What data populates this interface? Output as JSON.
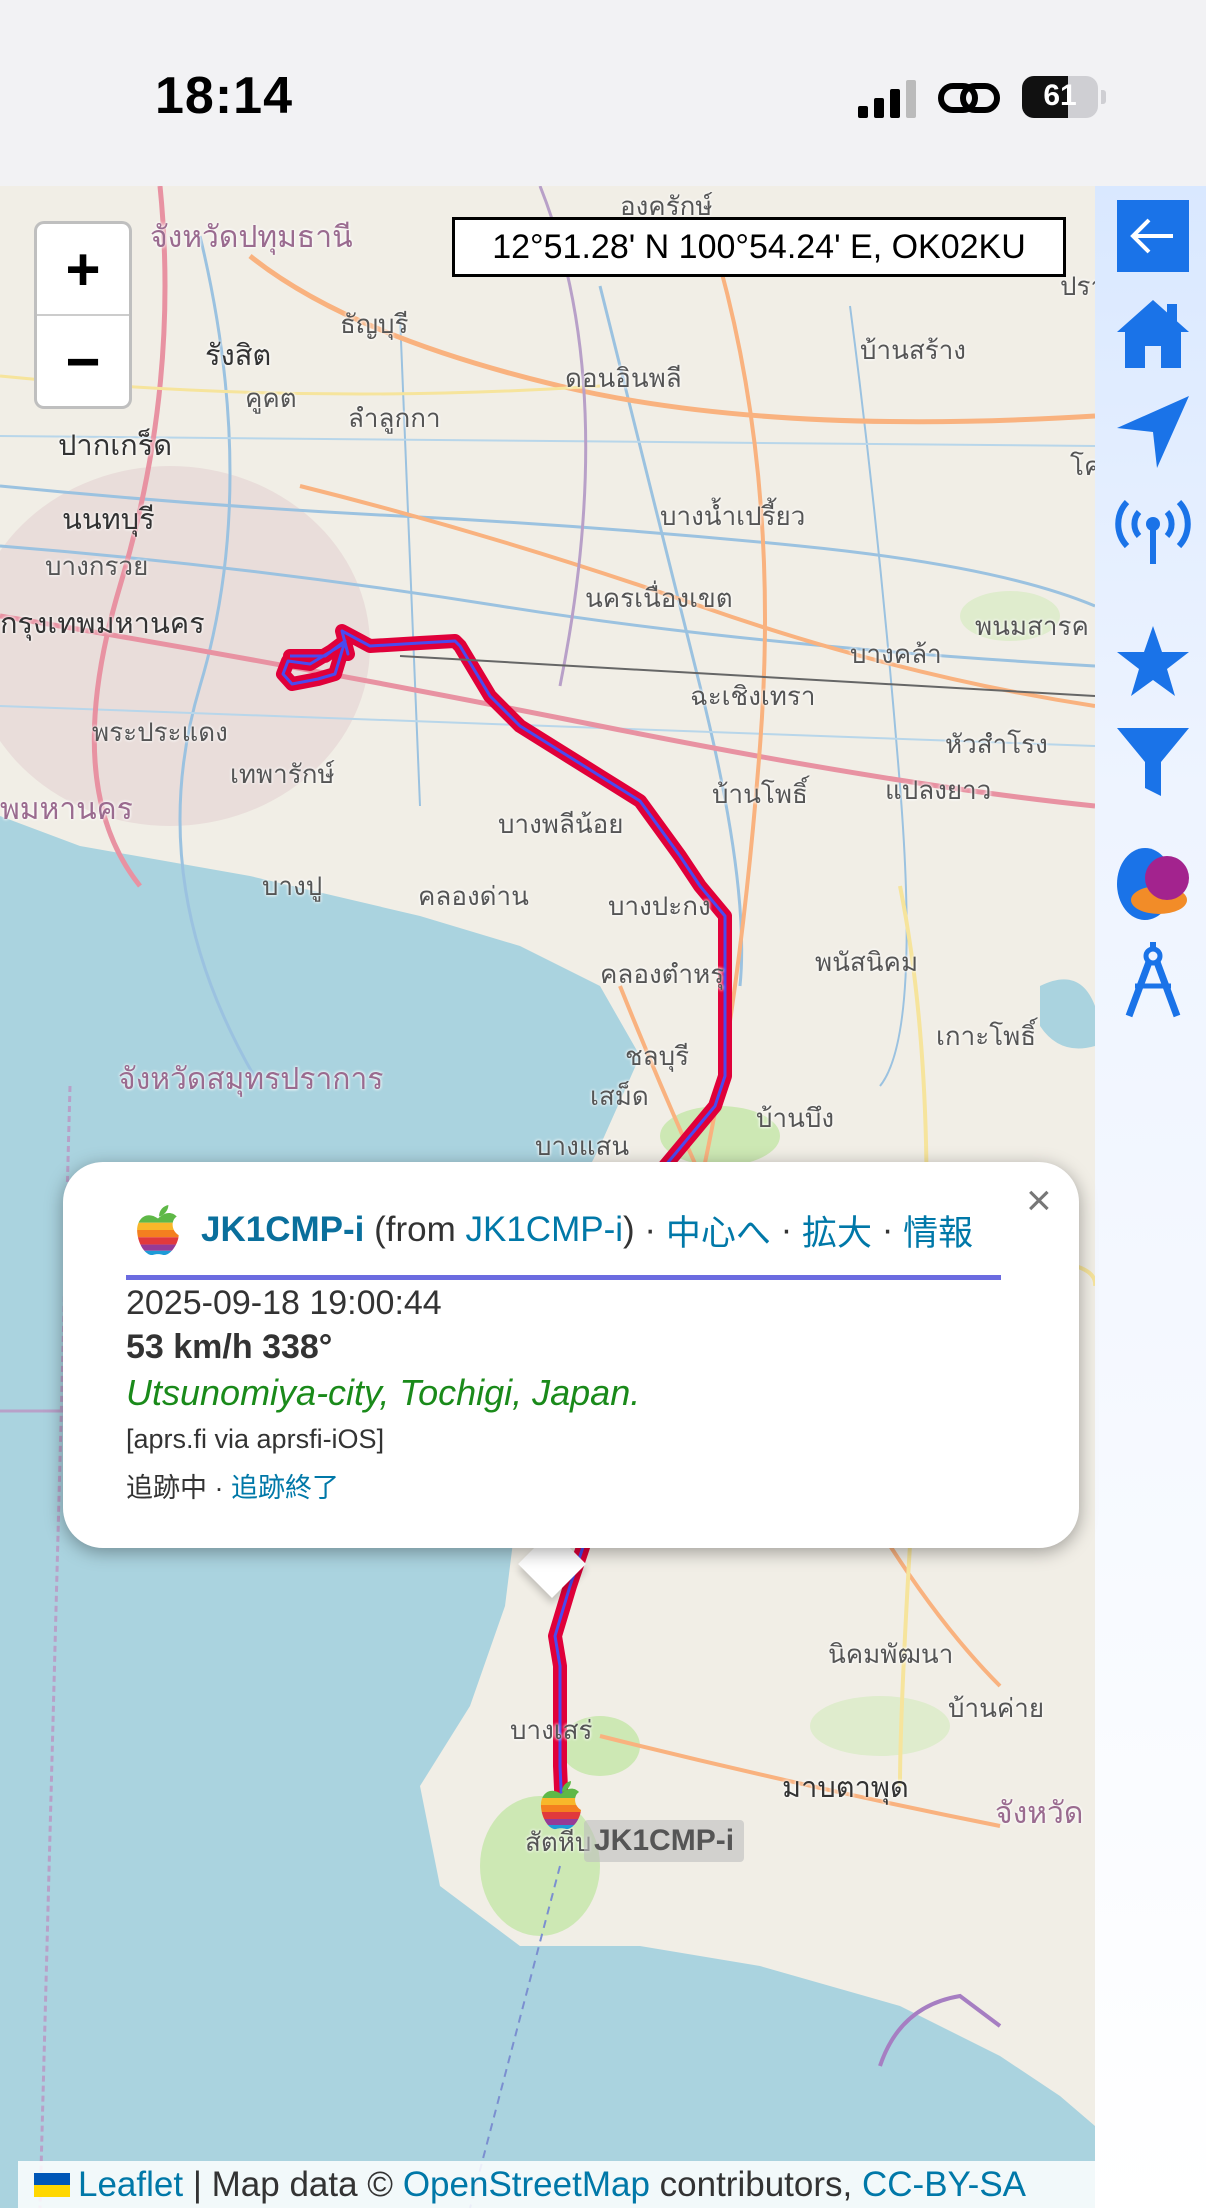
{
  "status_bar": {
    "time": "18:14",
    "battery_level": "61"
  },
  "map": {
    "coordinates": "12°51.28' N 100°54.24' E, OK02KU",
    "zoom_in_label": "+",
    "zoom_out_label": "−",
    "labels": [
      "องครักษ์",
      "จังหวัดปทุมธานี",
      "ธัญบุรี",
      "ปราจีน",
      "รังสิต",
      "คูคต",
      "ดอนอินพลี",
      "บ้านสร้าง",
      "ลำลูกกา",
      "ปากเกร็ด",
      "นนทบุรี",
      "บางกรวย",
      "บางน้ำเปรี้ยว",
      "โค",
      "กรุงเทพมหานคร",
      "นครเนื่องเขต",
      "พนมสารค",
      "บางคล้า",
      "ฉะเชิงเทรา",
      "พระประแดง",
      "เทพารักษ์",
      "หัวสำโรง",
      "บ้านโพธิ์",
      "แปลงยาว",
      "พมหานคร",
      "บางพลีน้อย",
      "บางปู",
      "คลองด่าน",
      "บางปะกง",
      "พนัสนิคม",
      "คลองตำหรุ",
      "เกาะโพธิ์",
      "จังหวัดสมุทรปราการ",
      "ชลบุรี",
      "เสม็ด",
      "บ้านบึง",
      "บางแสน",
      "นิคมพัฒนา",
      "บ้านค่าย",
      "บางเสร่",
      "มาบตาพุด",
      "จังหวัด",
      "สัตหีบ"
    ],
    "station_label": "JK1CMP-i",
    "attribution": {
      "leaflet": "Leaflet",
      "separator": "| Map data ©",
      "osm": "OpenStreetMap",
      "contributors": "contributors,",
      "license": "CC-BY-SA"
    }
  },
  "popup": {
    "callsign": "JK1CMP-i",
    "from_prefix": "(from",
    "from_callsign": "JK1CMP-i",
    "from_suffix": ") ·",
    "center_link": "中心へ",
    "sep1": "·",
    "zoom_link": "拡大",
    "sep2": "·",
    "info_link": "情報",
    "close_label": "×",
    "timestamp": "2025-09-18 19:00:44",
    "speed_course": "53 km/h 338°",
    "comment": "Utsunomiya-city, Tochigi, Japan.",
    "via": "[aprs.fi via aprsfi-iOS]",
    "tracking_text": "追跡中 ·",
    "stop_tracking_link": "追跡終了"
  },
  "toolbar": {
    "icons": [
      "back-arrow-icon",
      "home-icon",
      "navigation-icon",
      "broadcast-icon",
      "star-icon",
      "filter-icon",
      "blob-icon",
      "compass-icon"
    ],
    "accent": "#1a73e8"
  }
}
